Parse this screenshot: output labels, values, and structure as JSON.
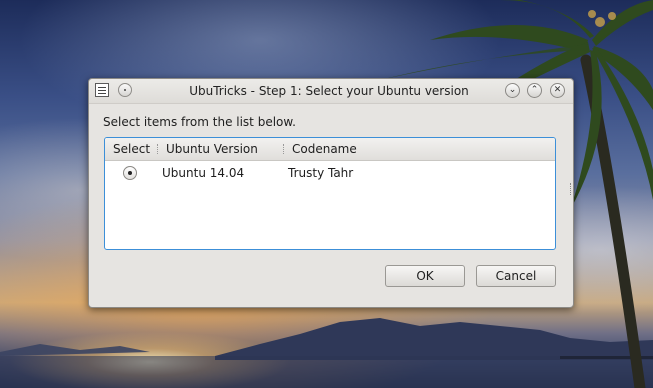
{
  "window": {
    "title": "UbuTricks - Step 1: Select your Ubuntu version",
    "controls": {
      "minimize": "⌄",
      "maximize": "⌃",
      "close": "✕"
    }
  },
  "instruction": "Select items from the list below.",
  "list": {
    "columns": [
      "Select",
      "Ubuntu Version",
      "Codename"
    ],
    "rows": [
      {
        "selected": true,
        "version": "Ubuntu 14.04",
        "codename": "Trusty Tahr"
      }
    ]
  },
  "buttons": {
    "ok": "OK",
    "cancel": "Cancel"
  },
  "icons": {
    "app": "app-menu-icon",
    "pin": "pin-icon",
    "minimize": "chevron-down-icon",
    "maximize": "chevron-up-icon",
    "close": "close-icon"
  },
  "colors": {
    "focus_border": "#3c8fd8",
    "dialog_bg": "#e6e4e1"
  }
}
